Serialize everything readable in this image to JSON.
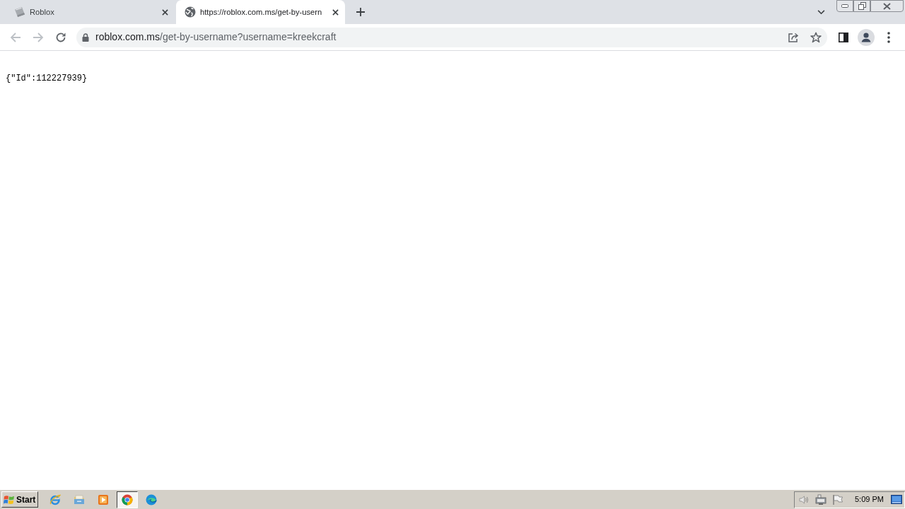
{
  "tabs": [
    {
      "title": "Roblox",
      "kind": "image",
      "selected": false
    },
    {
      "title": "https://roblox.com.ms/get-by-usern",
      "kind": "globe",
      "selected": true
    }
  ],
  "nav_buttons": [
    {
      "kind": "back",
      "disabled": true
    },
    {
      "kind": "forward",
      "disabled": true
    },
    {
      "kind": "reload",
      "disabled": false
    }
  ],
  "address": {
    "host": "roblox.com.ms",
    "path": "/get-by-username?username=kreekcraft"
  },
  "page": {
    "text": "{\"Id\":112227939}"
  },
  "taskbar": {
    "start_label": "Start",
    "apps": [
      {
        "kind": "ie",
        "selected": false
      },
      {
        "kind": "folder",
        "selected": false
      },
      {
        "kind": "player",
        "selected": false
      },
      {
        "kind": "chrome",
        "selected": true
      },
      {
        "kind": "edge",
        "selected": false
      }
    ],
    "clock": "5:09 PM"
  }
}
